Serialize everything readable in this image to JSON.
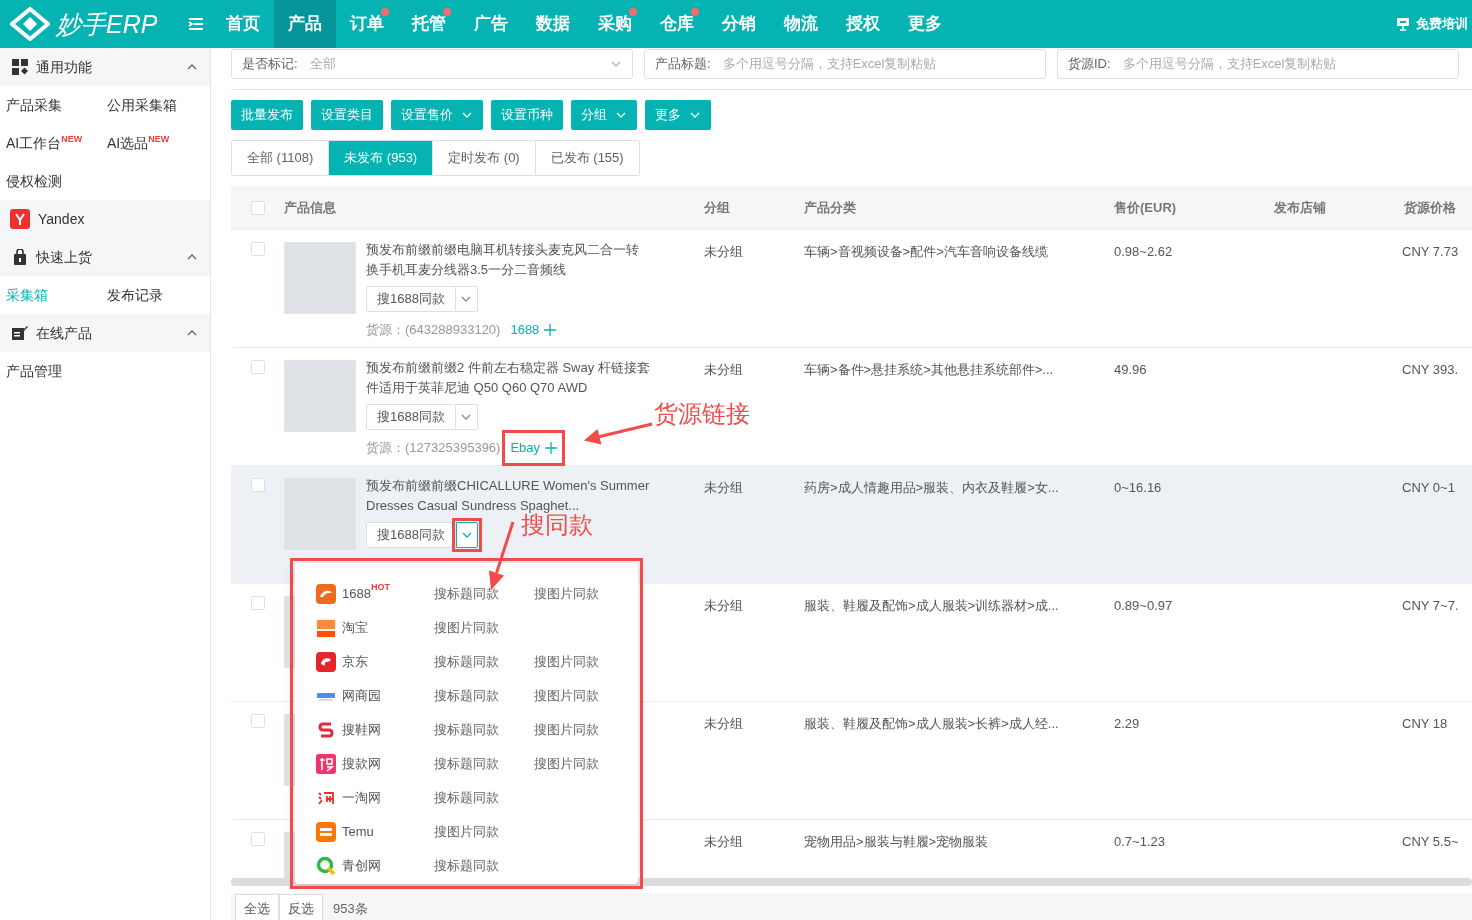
{
  "header": {
    "logo_text": "妙手ERP",
    "nav": [
      {
        "label": "首页",
        "selected": false,
        "dot": false
      },
      {
        "label": "产品",
        "selected": true,
        "dot": false
      },
      {
        "label": "订单",
        "selected": false,
        "dot": true
      },
      {
        "label": "托管",
        "selected": false,
        "dot": true
      },
      {
        "label": "广告",
        "selected": false,
        "dot": false
      },
      {
        "label": "数据",
        "selected": false,
        "dot": false
      },
      {
        "label": "采购",
        "selected": false,
        "dot": true
      },
      {
        "label": "仓库",
        "selected": false,
        "dot": true
      },
      {
        "label": "分销",
        "selected": false,
        "dot": false
      },
      {
        "label": "物流",
        "selected": false,
        "dot": false
      },
      {
        "label": "授权",
        "selected": false,
        "dot": false
      },
      {
        "label": "更多",
        "selected": false,
        "dot": false
      }
    ],
    "training": "免费培训"
  },
  "sidebar": {
    "sections": [
      {
        "kind": "group",
        "title": "通用功能",
        "expanded": true,
        "items": [
          {
            "label": "产品采集",
            "selected": false
          },
          {
            "label": "公用采集箱",
            "selected": false
          },
          {
            "label": "AI工作台",
            "badge": "NEW",
            "selected": false
          },
          {
            "label": "AI选品",
            "badge": "NEW",
            "selected": false
          },
          {
            "label": "侵权检测",
            "selected": false
          }
        ]
      },
      {
        "kind": "link",
        "title": "Yandex"
      },
      {
        "kind": "group",
        "title": "快速上货",
        "expanded": true,
        "items": [
          {
            "label": "采集箱",
            "selected": true
          },
          {
            "label": "发布记录",
            "selected": false
          }
        ]
      },
      {
        "kind": "group",
        "title": "在线产品",
        "expanded": true,
        "items": [
          {
            "label": "产品管理",
            "selected": false
          }
        ]
      }
    ]
  },
  "filters": [
    {
      "kind": "select",
      "label": "是否标记:",
      "value": "全部"
    },
    {
      "kind": "input",
      "label": "产品标题:",
      "placeholder": "多个用逗号分隔，支持Excel复制粘贴"
    },
    {
      "kind": "input",
      "label": "货源ID:",
      "placeholder": "多个用逗号分隔，支持Excel复制粘贴"
    }
  ],
  "toolbar": [
    {
      "label": "批量发布",
      "dropdown": false
    },
    {
      "label": "设置类目",
      "dropdown": false
    },
    {
      "label": "设置售价",
      "dropdown": true
    },
    {
      "label": "设置币种",
      "dropdown": false
    },
    {
      "label": "分组",
      "dropdown": true
    },
    {
      "label": "更多",
      "dropdown": true
    }
  ],
  "status_tabs": [
    {
      "label": "全部 (1108)",
      "selected": false
    },
    {
      "label": "未发布 (953)",
      "selected": true
    },
    {
      "label": "定时发布 (0)",
      "selected": false
    },
    {
      "label": "已发布 (155)",
      "selected": false
    }
  ],
  "table": {
    "header_checked": false,
    "columns": [
      "产品信息",
      "分组",
      "产品分类",
      "售价(EUR)",
      "发布店铺",
      "货源价格"
    ],
    "rows": [
      {
        "checked": false,
        "highlighted": false,
        "title": "预发布前缀前缀电脑耳机转接头麦克风二合一转换手机耳麦分线器3.5一分二音频线",
        "search_button": "搜1688同款",
        "search_open": false,
        "source": "货源：(643288933120)",
        "source_link": "1688",
        "group": "未分组",
        "category": "车辆>音视频设备>配件>汽车音响设备线缆",
        "price": "0.98~2.62",
        "source_price": "CNY 7.73"
      },
      {
        "checked": false,
        "highlighted": false,
        "title": "预发布前缀前缀2 件前左右稳定器 Sway 杆链接套件适用于英菲尼迪 Q50 Q60 Q70 AWD",
        "search_button": "搜1688同款",
        "search_open": false,
        "source": "货源：(127325395396)",
        "source_link": "Ebay",
        "group": "未分组",
        "category": "车辆>备件>悬挂系统>其他悬挂系统部件>...",
        "price": "49.96",
        "source_price": "CNY 393."
      },
      {
        "checked": false,
        "highlighted": true,
        "title": "预发布前缀前缀CHICALLURE Women's Summer Dresses Casual Sundress Spaghet...",
        "search_button": "搜1688同款",
        "search_open": true,
        "group": "未分组",
        "category": "药房>成人情趣用品>服装、内衣及鞋履>女...",
        "price": "0~16.16",
        "source_price": "CNY 0~1"
      },
      {
        "checked": false,
        "highlighted": false,
        "group": "未分组",
        "category": "服装、鞋履及配饰>成人服装>训练器材>成...",
        "price": "0.89~0.97",
        "source_price": "CNY 7~7."
      },
      {
        "checked": false,
        "highlighted": false,
        "group": "未分组",
        "category": "服装、鞋履及配饰>成人服装>长裤>成人经...",
        "price": "2.29",
        "source_price": "CNY 18"
      },
      {
        "checked": false,
        "highlighted": false,
        "group": "未分组",
        "category": "宠物用品>服装与鞋履>宠物服装",
        "price": "0.7~1.23",
        "source_price": "CNY 5.5~"
      }
    ]
  },
  "search_dropdown": {
    "items": [
      {
        "name": "1688",
        "badge": "HOT",
        "actions": [
          "搜标题同款",
          "搜图片同款"
        ]
      },
      {
        "name": "淘宝",
        "actions": [
          "搜图片同款"
        ]
      },
      {
        "name": "京东",
        "actions": [
          "搜标题同款",
          "搜图片同款"
        ]
      },
      {
        "name": "网商园",
        "actions": [
          "搜标题同款",
          "搜图片同款"
        ]
      },
      {
        "name": "搜鞋网",
        "actions": [
          "搜标题同款",
          "搜图片同款"
        ]
      },
      {
        "name": "搜款网",
        "actions": [
          "搜标题同款",
          "搜图片同款"
        ]
      },
      {
        "name": "一淘网",
        "actions": [
          "搜标题同款"
        ]
      },
      {
        "name": "Temu",
        "actions": [
          "搜图片同款"
        ]
      },
      {
        "name": "青创网",
        "actions": [
          "搜标题同款"
        ]
      }
    ]
  },
  "footer": {
    "select_all": "全选",
    "invert": "反选",
    "count": "953条"
  },
  "annotations": [
    {
      "kind": "box"
    },
    {
      "kind": "callout",
      "text": "货源链接"
    },
    {
      "kind": "box"
    },
    {
      "kind": "callout",
      "text": "搜同款"
    },
    {
      "kind": "box"
    }
  ]
}
